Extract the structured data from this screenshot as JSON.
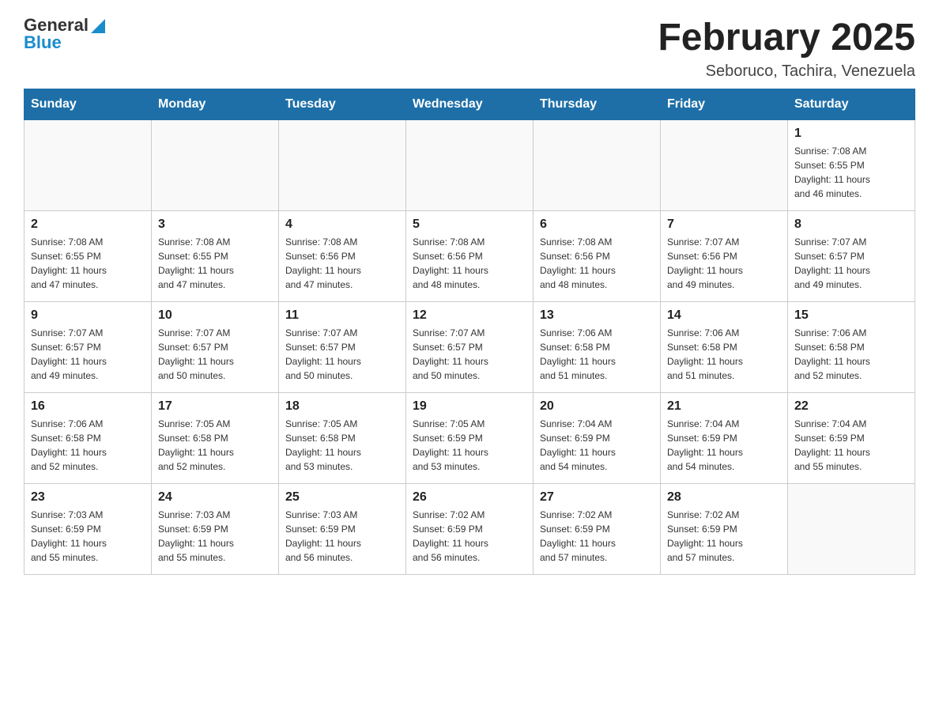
{
  "header": {
    "logo": {
      "general": "General",
      "blue": "Blue"
    },
    "title": "February 2025",
    "subtitle": "Seboruco, Tachira, Venezuela"
  },
  "days_of_week": [
    "Sunday",
    "Monday",
    "Tuesday",
    "Wednesday",
    "Thursday",
    "Friday",
    "Saturday"
  ],
  "weeks": [
    [
      {
        "day": "",
        "info": ""
      },
      {
        "day": "",
        "info": ""
      },
      {
        "day": "",
        "info": ""
      },
      {
        "day": "",
        "info": ""
      },
      {
        "day": "",
        "info": ""
      },
      {
        "day": "",
        "info": ""
      },
      {
        "day": "1",
        "info": "Sunrise: 7:08 AM\nSunset: 6:55 PM\nDaylight: 11 hours\nand 46 minutes."
      }
    ],
    [
      {
        "day": "2",
        "info": "Sunrise: 7:08 AM\nSunset: 6:55 PM\nDaylight: 11 hours\nand 47 minutes."
      },
      {
        "day": "3",
        "info": "Sunrise: 7:08 AM\nSunset: 6:55 PM\nDaylight: 11 hours\nand 47 minutes."
      },
      {
        "day": "4",
        "info": "Sunrise: 7:08 AM\nSunset: 6:56 PM\nDaylight: 11 hours\nand 47 minutes."
      },
      {
        "day": "5",
        "info": "Sunrise: 7:08 AM\nSunset: 6:56 PM\nDaylight: 11 hours\nand 48 minutes."
      },
      {
        "day": "6",
        "info": "Sunrise: 7:08 AM\nSunset: 6:56 PM\nDaylight: 11 hours\nand 48 minutes."
      },
      {
        "day": "7",
        "info": "Sunrise: 7:07 AM\nSunset: 6:56 PM\nDaylight: 11 hours\nand 49 minutes."
      },
      {
        "day": "8",
        "info": "Sunrise: 7:07 AM\nSunset: 6:57 PM\nDaylight: 11 hours\nand 49 minutes."
      }
    ],
    [
      {
        "day": "9",
        "info": "Sunrise: 7:07 AM\nSunset: 6:57 PM\nDaylight: 11 hours\nand 49 minutes."
      },
      {
        "day": "10",
        "info": "Sunrise: 7:07 AM\nSunset: 6:57 PM\nDaylight: 11 hours\nand 50 minutes."
      },
      {
        "day": "11",
        "info": "Sunrise: 7:07 AM\nSunset: 6:57 PM\nDaylight: 11 hours\nand 50 minutes."
      },
      {
        "day": "12",
        "info": "Sunrise: 7:07 AM\nSunset: 6:57 PM\nDaylight: 11 hours\nand 50 minutes."
      },
      {
        "day": "13",
        "info": "Sunrise: 7:06 AM\nSunset: 6:58 PM\nDaylight: 11 hours\nand 51 minutes."
      },
      {
        "day": "14",
        "info": "Sunrise: 7:06 AM\nSunset: 6:58 PM\nDaylight: 11 hours\nand 51 minutes."
      },
      {
        "day": "15",
        "info": "Sunrise: 7:06 AM\nSunset: 6:58 PM\nDaylight: 11 hours\nand 52 minutes."
      }
    ],
    [
      {
        "day": "16",
        "info": "Sunrise: 7:06 AM\nSunset: 6:58 PM\nDaylight: 11 hours\nand 52 minutes."
      },
      {
        "day": "17",
        "info": "Sunrise: 7:05 AM\nSunset: 6:58 PM\nDaylight: 11 hours\nand 52 minutes."
      },
      {
        "day": "18",
        "info": "Sunrise: 7:05 AM\nSunset: 6:58 PM\nDaylight: 11 hours\nand 53 minutes."
      },
      {
        "day": "19",
        "info": "Sunrise: 7:05 AM\nSunset: 6:59 PM\nDaylight: 11 hours\nand 53 minutes."
      },
      {
        "day": "20",
        "info": "Sunrise: 7:04 AM\nSunset: 6:59 PM\nDaylight: 11 hours\nand 54 minutes."
      },
      {
        "day": "21",
        "info": "Sunrise: 7:04 AM\nSunset: 6:59 PM\nDaylight: 11 hours\nand 54 minutes."
      },
      {
        "day": "22",
        "info": "Sunrise: 7:04 AM\nSunset: 6:59 PM\nDaylight: 11 hours\nand 55 minutes."
      }
    ],
    [
      {
        "day": "23",
        "info": "Sunrise: 7:03 AM\nSunset: 6:59 PM\nDaylight: 11 hours\nand 55 minutes."
      },
      {
        "day": "24",
        "info": "Sunrise: 7:03 AM\nSunset: 6:59 PM\nDaylight: 11 hours\nand 55 minutes."
      },
      {
        "day": "25",
        "info": "Sunrise: 7:03 AM\nSunset: 6:59 PM\nDaylight: 11 hours\nand 56 minutes."
      },
      {
        "day": "26",
        "info": "Sunrise: 7:02 AM\nSunset: 6:59 PM\nDaylight: 11 hours\nand 56 minutes."
      },
      {
        "day": "27",
        "info": "Sunrise: 7:02 AM\nSunset: 6:59 PM\nDaylight: 11 hours\nand 57 minutes."
      },
      {
        "day": "28",
        "info": "Sunrise: 7:02 AM\nSunset: 6:59 PM\nDaylight: 11 hours\nand 57 minutes."
      },
      {
        "day": "",
        "info": ""
      }
    ]
  ]
}
